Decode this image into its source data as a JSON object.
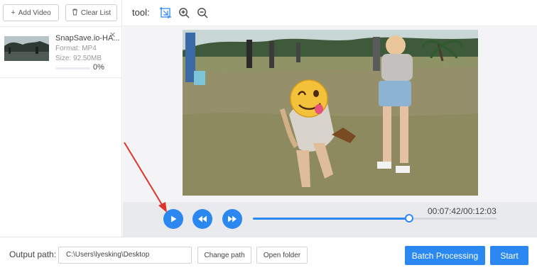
{
  "left": {
    "add_video_label": "Add Video",
    "clear_list_label": "Clear List",
    "file": {
      "name": "SnapSave.io-HA...",
      "format": "Format:  MP4",
      "size": "Size:  92.50MB",
      "progress_percent": "0%",
      "progress_fraction": 0.0
    }
  },
  "toolbar": {
    "tool_label": "tool:",
    "icons": [
      "crop-icon",
      "zoom-in-icon",
      "zoom-out-icon"
    ]
  },
  "player": {
    "time": "00:07:42/00:12:03",
    "seek_fraction": 0.64,
    "buttons": [
      "play-icon",
      "rewind-icon",
      "fast-forward-icon"
    ]
  },
  "bottom": {
    "output_label": "Output path:",
    "output_value": "C:\\Users\\lyesking\\Desktop",
    "change_path_label": "Change path",
    "open_folder_label": "Open folder",
    "batch_label": "Batch Processing",
    "start_label": "Start"
  },
  "colors": {
    "accent": "#2b88f0",
    "annotation_arrow": "#e0332e"
  }
}
